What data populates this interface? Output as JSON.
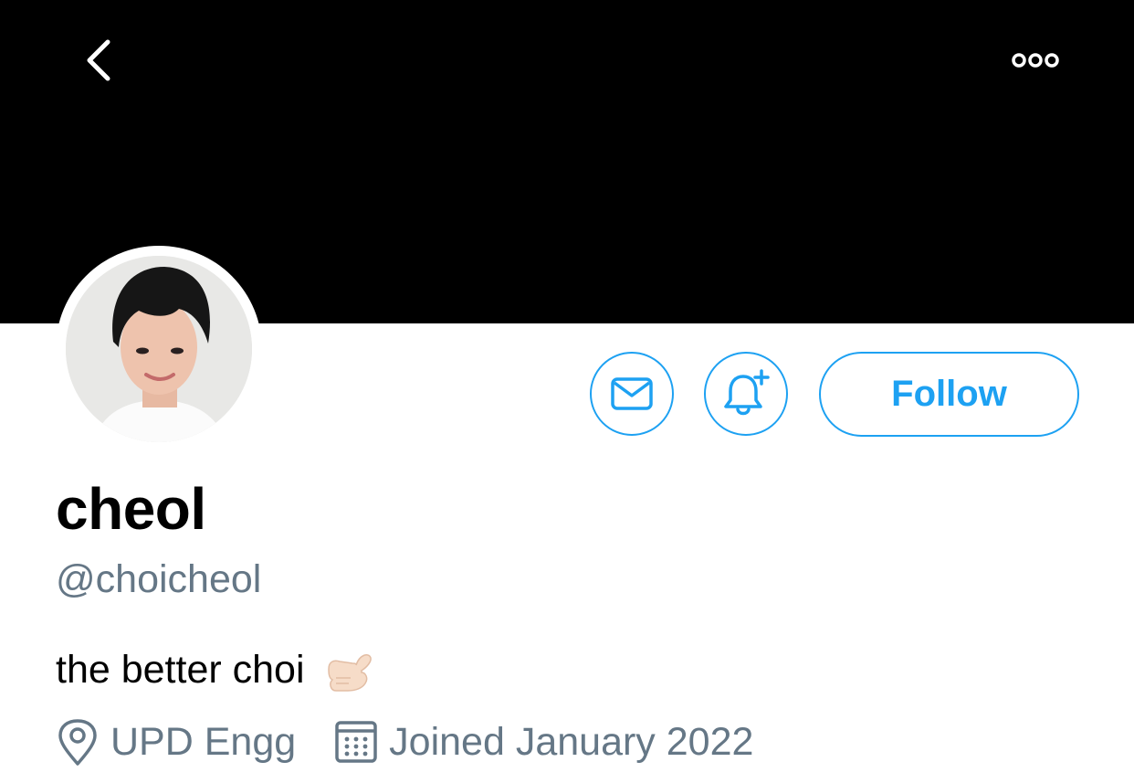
{
  "header": {
    "back_icon": "chevron-left-icon",
    "more_icon": "ellipsis-icon",
    "banner_color": "#000000"
  },
  "profile": {
    "display_name": "cheol",
    "handle": "@choicheol",
    "bio": "the better choi",
    "bio_emoji": "🤙🏻",
    "location": "UPD Engg",
    "joined": "Joined January 2022"
  },
  "actions": {
    "message_icon": "envelope-icon",
    "notify_icon": "bell-plus-icon",
    "follow_label": "Follow"
  },
  "colors": {
    "accent": "#1da1f2",
    "secondary_text": "#657786"
  }
}
